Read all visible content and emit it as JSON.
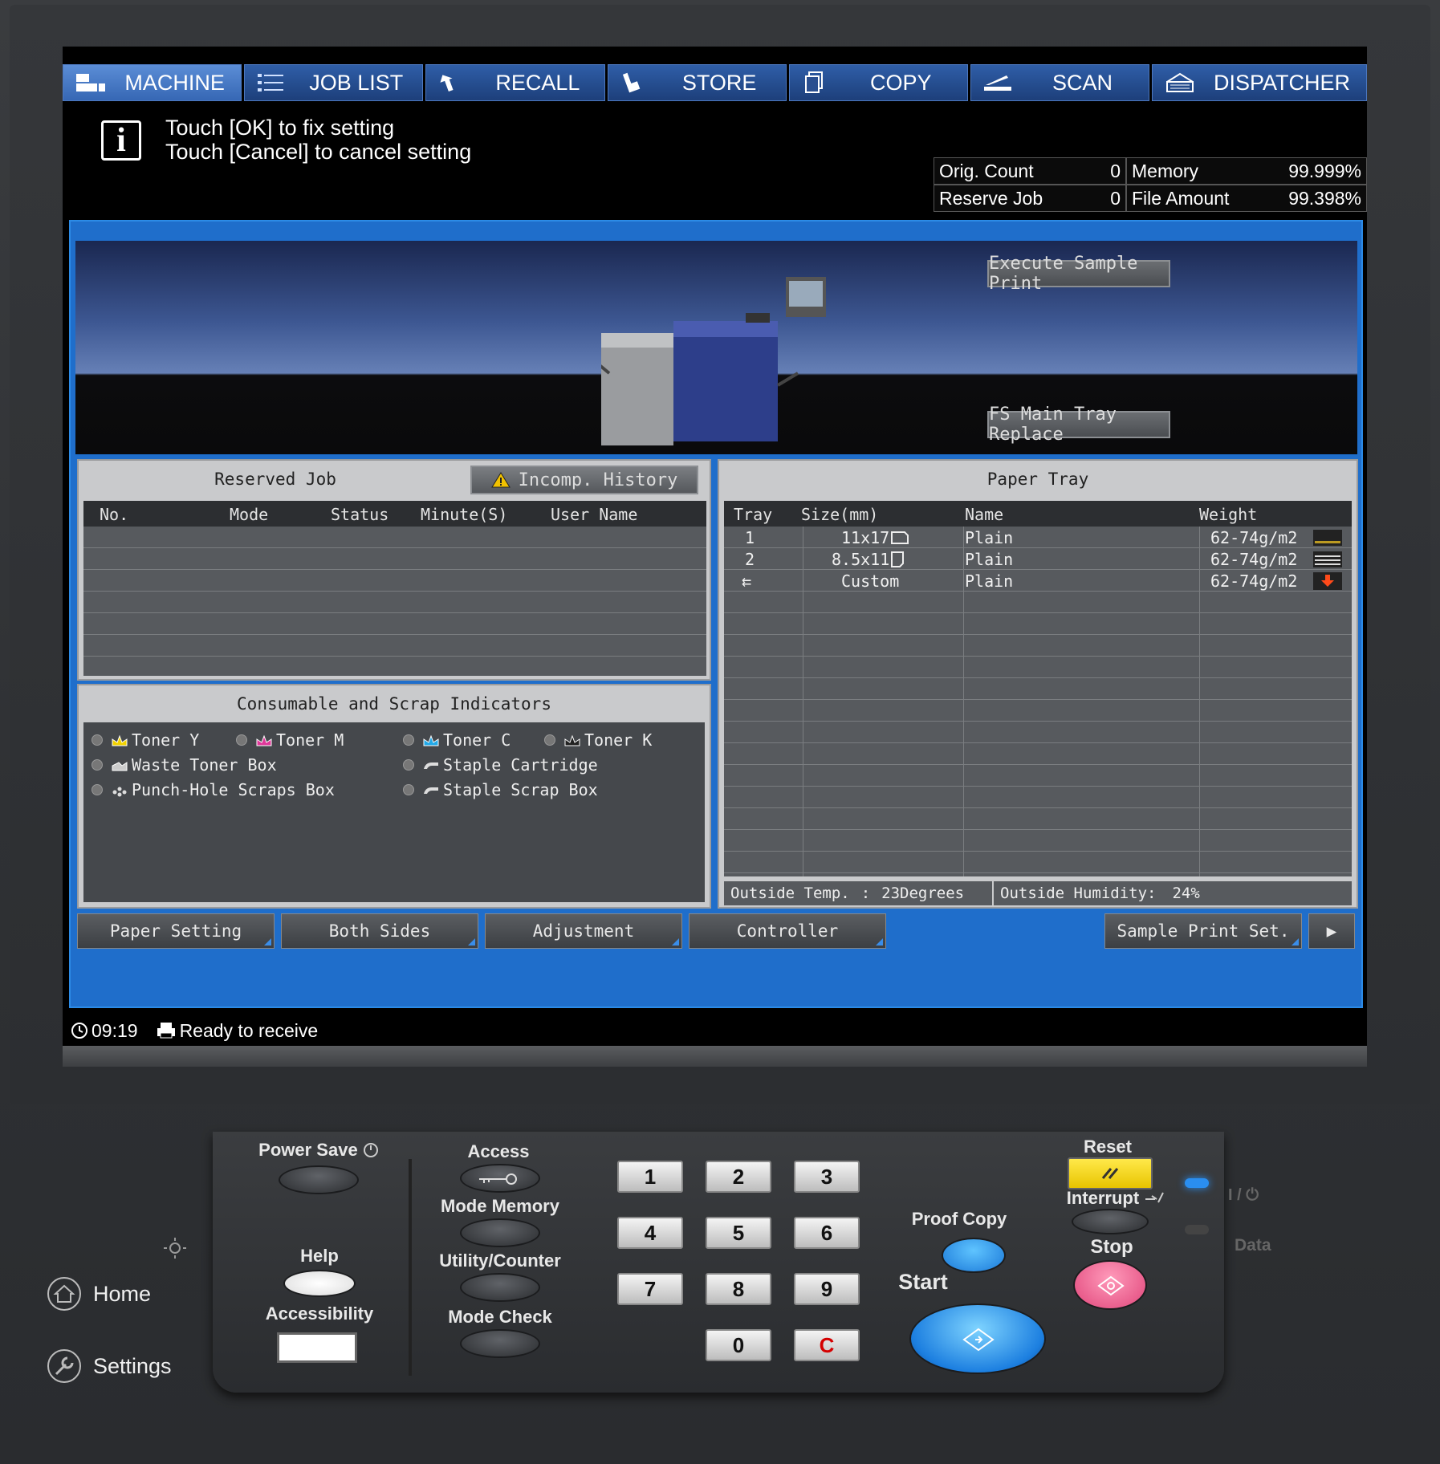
{
  "tabs": [
    {
      "label": "MACHINE",
      "icon": "machine-icon",
      "active": true
    },
    {
      "label": "JOB LIST",
      "icon": "list-icon"
    },
    {
      "label": "RECALL",
      "icon": "recall-icon"
    },
    {
      "label": "STORE",
      "icon": "store-icon"
    },
    {
      "label": "COPY",
      "icon": "copy-icon"
    },
    {
      "label": "SCAN",
      "icon": "scan-icon"
    },
    {
      "label": "DISPATCHER",
      "icon": "dispatcher-icon"
    }
  ],
  "message": {
    "line1": "Touch [OK] to fix setting",
    "line2": "Touch [Cancel] to cancel setting"
  },
  "counters": {
    "orig_count_label": "Orig. Count",
    "orig_count_value": "0",
    "memory_label": "Memory",
    "memory_value": "99.999%",
    "reserve_job_label": "Reserve Job",
    "reserve_job_value": "0",
    "file_amount_label": "File Amount",
    "file_amount_value": "99.398%"
  },
  "hero": {
    "execute_sample_print": "Execute Sample Print",
    "fs_main_tray_replace": "FS Main Tray Replace"
  },
  "reserved_job": {
    "title": "Reserved Job",
    "incomp_history": "Incomp. History",
    "columns": [
      "No.",
      "Mode",
      "Status",
      "Minute(S)",
      "User Name"
    ]
  },
  "consumables": {
    "title": "Consumable and Scrap Indicators",
    "items": [
      "Toner Y",
      "Toner M",
      "Toner C",
      "Toner K",
      "Waste Toner Box",
      "Staple Cartridge",
      "Punch-Hole Scraps Box",
      "Staple Scrap Box"
    ]
  },
  "paper_tray": {
    "title": "Paper Tray",
    "columns": [
      "Tray",
      "Size(mm)",
      "Name",
      "Weight"
    ],
    "rows": [
      {
        "tray": "1",
        "size": "11x17",
        "name": "Plain",
        "weight": "62-74g/m2"
      },
      {
        "tray": "2",
        "size": "8.5x11",
        "name": "Plain",
        "weight": "62-74g/m2"
      },
      {
        "tray": "⇇",
        "size": "Custom",
        "name": "Plain",
        "weight": "62-74g/m2"
      }
    ],
    "outside_temp_label": "Outside Temp.",
    "outside_temp_sep": ":",
    "outside_temp_value": "23Degrees",
    "outside_humidity_label": "Outside Humidity:",
    "outside_humidity_value": "24%"
  },
  "bottom_tabs": [
    "Paper Setting",
    "Both Sides",
    "Adjustment",
    "Controller",
    "Sample Print Set.",
    "▶"
  ],
  "status": {
    "time": "09:19",
    "state": "Ready to receive"
  },
  "control_panel": {
    "power_save": "Power Save",
    "access": "Access",
    "mode_memory": "Mode Memory",
    "utility_counter": "Utility/Counter",
    "mode_check": "Mode Check",
    "help": "Help",
    "accessibility": "Accessibility",
    "keys": [
      "1",
      "2",
      "3",
      "4",
      "5",
      "6",
      "7",
      "8",
      "9",
      "0",
      "C"
    ],
    "proof_copy": "Proof Copy",
    "start": "Start",
    "reset": "Reset",
    "interrupt": "Interrupt",
    "stop": "Stop",
    "power_label": "I / ⏻",
    "data_label": "Data"
  },
  "side": {
    "home": "Home",
    "settings": "Settings"
  }
}
